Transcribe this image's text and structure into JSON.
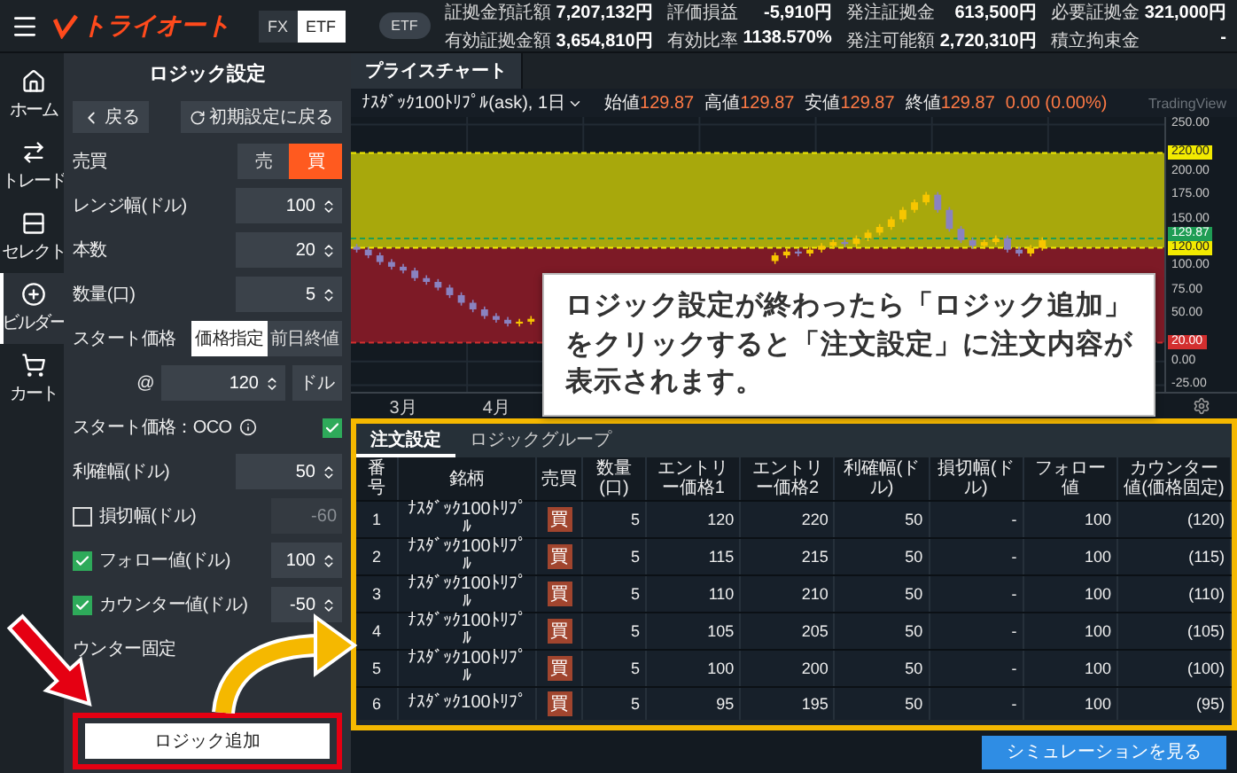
{
  "header": {
    "logo": "トライオート",
    "market_tabs": [
      {
        "label": "FX",
        "selected": false
      },
      {
        "label": "ETF",
        "selected": true
      }
    ],
    "badge": "ETF",
    "account": [
      [
        {
          "label": "証拠金預託額",
          "value": "7,207,132円"
        },
        {
          "label": "評価損益",
          "value": "-5,910円"
        },
        {
          "label": "発注証拠金",
          "value": "613,500円"
        },
        {
          "label": "必要証拠金",
          "value": "321,000円"
        }
      ],
      [
        {
          "label": "有効証拠金額",
          "value": "3,654,810円"
        },
        {
          "label": "有効比率",
          "value": "1138.570%"
        },
        {
          "label": "発注可能額",
          "value": "2,720,310円"
        },
        {
          "label": "積立拘束金",
          "value": "-"
        }
      ]
    ]
  },
  "nav": [
    {
      "kind": "home",
      "label": "ホーム",
      "selected": false
    },
    {
      "kind": "trade",
      "label": "トレード",
      "selected": false
    },
    {
      "kind": "select",
      "label": "セレクト",
      "selected": false
    },
    {
      "kind": "builder",
      "label": "ビルダー",
      "selected": true
    },
    {
      "kind": "cart",
      "label": "カート",
      "selected": false
    }
  ],
  "logic_panel": {
    "title": "ロジック設定",
    "back_button": "戻る",
    "reset_button": "初期設定に戻る",
    "fields": [
      {
        "kind": "side",
        "label": "売買",
        "options": [
          {
            "label": "売",
            "selected": false
          },
          {
            "label": "買",
            "selected": true
          }
        ]
      },
      {
        "kind": "number",
        "label": "レンジ幅(ドル)",
        "value": "100"
      },
      {
        "kind": "number",
        "label": "本数",
        "value": "20"
      },
      {
        "kind": "number",
        "label": "数量(口)",
        "value": "5"
      },
      {
        "kind": "segment",
        "label": "スタート価格",
        "options": [
          {
            "label": "価格指定",
            "selected": true
          },
          {
            "label": "前日終値",
            "selected": false
          }
        ]
      },
      {
        "kind": "price",
        "label": "@",
        "value": "120",
        "unit": "ドル"
      },
      {
        "kind": "toggle",
        "label": "スタート価格：OCO",
        "checked": true
      },
      {
        "kind": "number",
        "label": "利確幅(ドル)",
        "value": "50"
      },
      {
        "kind": "check-number",
        "label": "損切幅(ドル)",
        "checked": false,
        "value": "-60",
        "disabled": true
      },
      {
        "kind": "check-number",
        "label": "フォロー値(ドル)",
        "checked": true,
        "value": "100",
        "disabled": false
      },
      {
        "kind": "check-number",
        "label": "カウンター値(ドル)",
        "checked": true,
        "value": "-50",
        "disabled": false
      },
      {
        "kind": "text",
        "label": "ウンター固定"
      }
    ],
    "add_button": "ロジック追加"
  },
  "chart": {
    "tab": {
      "label": "プライスチャート",
      "selected": true
    },
    "symbol": "ﾅｽﾀﾞｯｸ100ﾄﾘﾌﾟﾙ(ask), 1日",
    "ohlc": [
      {
        "label": "始値",
        "value": "129.87"
      },
      {
        "label": "高値",
        "value": "129.87"
      },
      {
        "label": "安値",
        "value": "129.87"
      },
      {
        "label": "終値",
        "value": "129.87"
      }
    ],
    "change": "0.00 (0.00%)",
    "brand": "TradingView",
    "chart_data": {
      "type": "candlestick",
      "categories": [
        null,
        null,
        null,
        null,
        "3月",
        null,
        null,
        null,
        null,
        null,
        null,
        null,
        "4月",
        null,
        null,
        null,
        null,
        null,
        null,
        null,
        null,
        null,
        null,
        null,
        null,
        null,
        null,
        null,
        null,
        null,
        null,
        null,
        null,
        null,
        null,
        null,
        null,
        null,
        null,
        null,
        null,
        null,
        null,
        null,
        null,
        null,
        null,
        null,
        null,
        null,
        null,
        null,
        null,
        null,
        null,
        null,
        null,
        null,
        null,
        null,
        null,
        null,
        null,
        null,
        null,
        null,
        null,
        null,
        null,
        null
      ],
      "ohlc": [
        [
          121,
          124,
          115,
          118
        ],
        [
          118,
          121,
          109,
          112
        ],
        [
          112,
          115,
          102,
          105
        ],
        [
          105,
          108,
          97,
          100
        ],
        [
          100,
          103,
          93,
          96
        ],
        [
          96,
          99,
          85,
          88
        ],
        [
          88,
          91,
          81,
          84
        ],
        [
          84,
          87,
          75,
          78
        ],
        [
          78,
          81,
          67,
          70
        ],
        [
          70,
          73,
          59,
          62
        ],
        [
          62,
          65,
          52,
          55
        ],
        [
          55,
          58,
          45,
          48
        ],
        [
          48,
          51,
          41,
          44
        ],
        [
          44,
          47,
          37,
          40
        ],
        [
          40,
          45,
          37,
          42
        ],
        [
          42,
          48,
          39,
          45
        ],
        null,
        null,
        null,
        null,
        null,
        null,
        null,
        null,
        null,
        null,
        null,
        null,
        null,
        null,
        null,
        null,
        null,
        null,
        null,
        null,
        [
          106,
          115,
          103,
          112
        ],
        [
          112,
          119,
          109,
          116
        ],
        [
          116,
          119,
          111,
          114
        ],
        [
          114,
          121,
          111,
          118
        ],
        [
          118,
          125,
          115,
          122
        ],
        [
          122,
          129,
          119,
          126
        ],
        [
          126,
          129,
          121,
          124
        ],
        [
          124,
          133,
          121,
          130
        ],
        [
          130,
          139,
          127,
          136
        ],
        [
          136,
          145,
          133,
          142
        ],
        [
          142,
          153,
          139,
          150
        ],
        [
          150,
          163,
          147,
          160
        ],
        [
          160,
          171,
          157,
          168
        ],
        [
          168,
          179,
          165,
          176
        ],
        [
          176,
          179,
          157,
          160
        ],
        [
          160,
          163,
          137,
          140
        ],
        [
          140,
          143,
          125,
          128
        ],
        [
          128,
          131,
          119,
          122
        ],
        [
          122,
          129,
          119,
          126
        ],
        [
          126,
          133,
          123,
          130
        ],
        [
          130,
          133,
          115,
          118
        ],
        [
          118,
          121,
          111,
          114
        ],
        [
          114,
          123,
          111,
          120
        ],
        [
          120,
          131,
          117,
          128
        ],
        null,
        null,
        null,
        null,
        null,
        null,
        null,
        null,
        null,
        null
      ],
      "ylim": [
        -32,
        258
      ],
      "grid": true,
      "yticks": [
        {
          "value": 250,
          "label": "250.00"
        },
        {
          "value": 200,
          "label": "200.00"
        },
        {
          "value": 175,
          "label": "175.00"
        },
        {
          "value": 150,
          "label": "150.00"
        },
        {
          "value": 100,
          "label": "100.00"
        },
        {
          "value": 75,
          "label": "75.00"
        },
        {
          "value": 50,
          "label": "50.00"
        },
        {
          "value": 0,
          "label": "0.00"
        },
        {
          "value": -25,
          "label": "-25.00"
        }
      ],
      "ref_lines": [
        {
          "axis": "y",
          "value": 220,
          "label": "220.00",
          "color": "#f2ea00"
        },
        {
          "axis": "y",
          "value": 129.87,
          "label": "129.87",
          "color": "#1f9d55"
        },
        {
          "axis": "y",
          "value": 120,
          "label": "120.00",
          "color": "#f2ea00"
        },
        {
          "axis": "y",
          "value": 20,
          "label": "20.00",
          "color": "#d32f2f"
        }
      ],
      "bands": [
        {
          "axis": "y",
          "from": 120,
          "to": 220,
          "color": "#a8a80c"
        },
        {
          "axis": "y",
          "from": 20,
          "to": 120,
          "color": "#7d1a26"
        }
      ]
    }
  },
  "orders": {
    "tabs": [
      {
        "label": "注文設定",
        "selected": true
      },
      {
        "label": "ロジックグループ",
        "selected": false
      }
    ],
    "columns": [
      "番号",
      "銘柄",
      "売買",
      "数量(口)",
      "エントリー価格1",
      "エントリー価格2",
      "利確幅(ドル)",
      "損切幅(ドル)",
      "フォロー値",
      "カウンター値(価格固定)"
    ],
    "rows": [
      {
        "no": "1",
        "symbol": "ﾅｽﾀﾞｯｸ100ﾄﾘﾌﾟﾙ",
        "side": "買",
        "qty": "5",
        "entry1": "120",
        "entry2": "220",
        "profit": "50",
        "loss": "-",
        "follow": "100",
        "counter": "(120)"
      },
      {
        "no": "2",
        "symbol": "ﾅｽﾀﾞｯｸ100ﾄﾘﾌﾟﾙ",
        "side": "買",
        "qty": "5",
        "entry1": "115",
        "entry2": "215",
        "profit": "50",
        "loss": "-",
        "follow": "100",
        "counter": "(115)"
      },
      {
        "no": "3",
        "symbol": "ﾅｽﾀﾞｯｸ100ﾄﾘﾌﾟﾙ",
        "side": "買",
        "qty": "5",
        "entry1": "110",
        "entry2": "210",
        "profit": "50",
        "loss": "-",
        "follow": "100",
        "counter": "(110)"
      },
      {
        "no": "4",
        "symbol": "ﾅｽﾀﾞｯｸ100ﾄﾘﾌﾟﾙ",
        "side": "買",
        "qty": "5",
        "entry1": "105",
        "entry2": "205",
        "profit": "50",
        "loss": "-",
        "follow": "100",
        "counter": "(105)"
      },
      {
        "no": "5",
        "symbol": "ﾅｽﾀﾞｯｸ100ﾄﾘﾌﾟﾙ",
        "side": "買",
        "qty": "5",
        "entry1": "100",
        "entry2": "200",
        "profit": "50",
        "loss": "-",
        "follow": "100",
        "counter": "(100)"
      },
      {
        "no": "6",
        "symbol": "ﾅｽﾀﾞｯｸ100ﾄﾘﾌﾟ",
        "side": "買",
        "qty": "5",
        "entry1": "95",
        "entry2": "195",
        "profit": "50",
        "loss": "-",
        "follow": "100",
        "counter": "(95)"
      }
    ]
  },
  "simulation_button": "シミュレーションを見る",
  "callout": "ロジック設定が終わったら「ロジック追加」をクリックすると「注文設定」に注文内容が表示されます。"
}
